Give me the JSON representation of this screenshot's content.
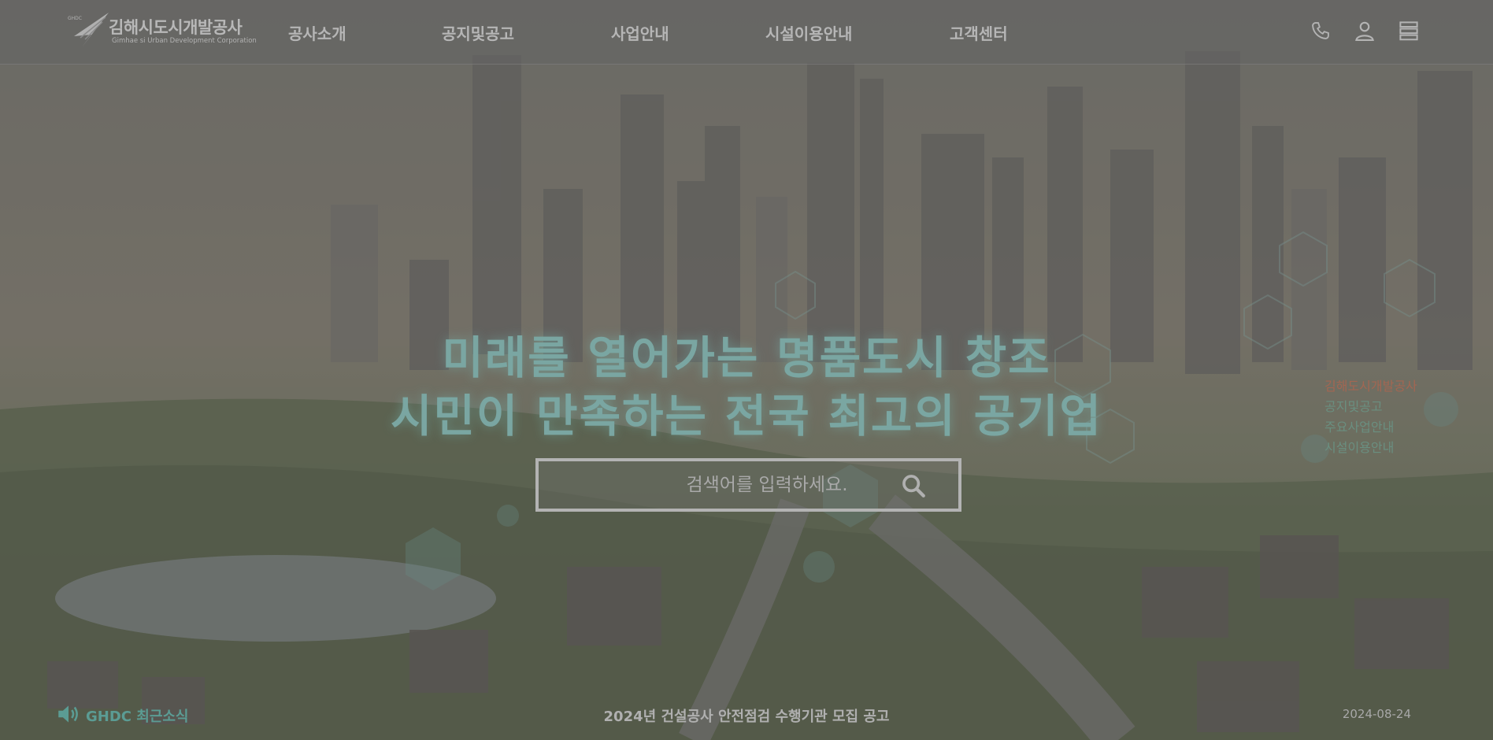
{
  "brand": {
    "name_ko": "김해시도시개발공사",
    "name_en": "Gimhae si Urban Development Corporation",
    "mark_text": "GHDC"
  },
  "nav": {
    "items": [
      {
        "label": "공사소개"
      },
      {
        "label": "공지및공고"
      },
      {
        "label": "사업안내"
      },
      {
        "label": "시설이용안내"
      },
      {
        "label": "고객센터"
      }
    ]
  },
  "header_icons": [
    "phone-icon",
    "user-icon",
    "menu-icon"
  ],
  "hero": {
    "slogan_line1": "미래를 열어가는 명품도시 창조",
    "slogan_line2": "시민이 만족하는 전국 최고의 공기업"
  },
  "search": {
    "placeholder": "검색어를 입력하세요.",
    "value": ""
  },
  "side_list": [
    "김해도시개발공사",
    "공지및공고",
    "주요사업안내",
    "시설이용안내"
  ],
  "news": {
    "label": "GHDC 최근소식",
    "title": "2024년 건설공사 안전점검 수행기관 모집 공고",
    "date": "2024-08-24"
  },
  "colors": {
    "accent_teal": "#5b9c94",
    "slogan": "#7aa6a2",
    "header_text": "#b6b6b6"
  }
}
